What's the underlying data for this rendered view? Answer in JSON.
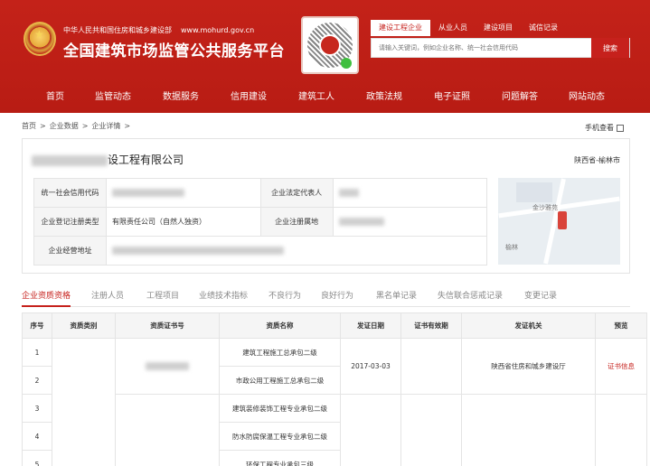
{
  "header": {
    "ministry": "中华人民共和国住房和城乡建设部",
    "url": "www.mohurd.gov.cn",
    "title": "全国建筑市场监管公共服务平台",
    "colors": {
      "brand": "#c6211c",
      "accent": "#c6211c"
    }
  },
  "search": {
    "tabs": [
      "建设工程企业",
      "从业人员",
      "建设项目",
      "诚信记录"
    ],
    "active_tab": 0,
    "placeholder": "请输入关键词，例如企业名称、统一社会信用代码",
    "button": "搜索"
  },
  "nav": [
    "首页",
    "监管动态",
    "数据服务",
    "信用建设",
    "建筑工人",
    "政策法规",
    "电子证照",
    "问题解答",
    "网站动态"
  ],
  "breadcrumb": [
    "首页",
    ">",
    "企业数据",
    ">",
    "企业详情",
    ">"
  ],
  "mobile_view": "手机查看",
  "company": {
    "name_visible": "设工程有限公司",
    "location": "陕西省-榆林市",
    "fields": {
      "credit_code_label": "统一社会信用代码",
      "legal_rep_label": "企业法定代表人",
      "reg_type_label": "企业登记注册类型",
      "reg_type_value": "有限责任公司（自然人独资）",
      "reg_place_label": "企业注册属地",
      "address_label": "企业经营地址"
    },
    "map_label": "金沙雅苑",
    "map_label2": "榆林"
  },
  "tabs": [
    "企业资质资格",
    "注册人员",
    "工程项目",
    "业绩技术指标",
    "不良行为",
    "良好行为",
    "黑名单记录",
    "失信联合惩戒记录",
    "变更记录"
  ],
  "active_tab": 0,
  "qual_table": {
    "headers": [
      "序号",
      "资质类别",
      "资质证书号",
      "资质名称",
      "发证日期",
      "证书有效期",
      "发证机关",
      "预览"
    ],
    "rows": [
      {
        "no": "1",
        "name": "建筑工程施工总承包二级"
      },
      {
        "no": "2",
        "name": "市政公用工程施工总承包二级"
      },
      {
        "no": "3",
        "name": "建筑装修装饰工程专业承包二级"
      },
      {
        "no": "4",
        "name": "防水防腐保温工程专业承包二级"
      },
      {
        "no": "5",
        "name": "环保工程专业承包三级"
      }
    ],
    "issue_date": "2017-03-03",
    "issuer": "陕西省住房和城乡建设厅",
    "preview": "证书信息"
  }
}
